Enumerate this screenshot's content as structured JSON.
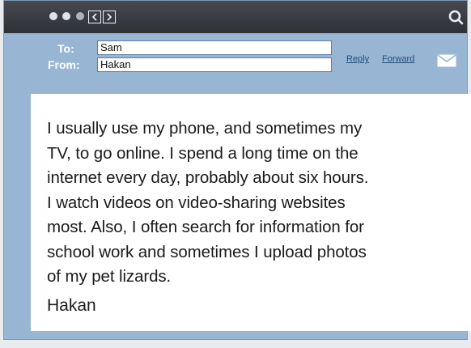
{
  "email": {
    "to_label": "To:",
    "to_value": "Sam",
    "from_label": "From:",
    "from_value": "Hakan",
    "reply_label": "Reply",
    "forward_label": "Forward",
    "message": "I usually use my phone, and sometimes my\nTV, to go online. I spend a long time on the\ninternet every day, probably about six hours.\nI watch videos on video-sharing websites\nmost. Also, I often search for information for\nschool work and sometimes I upload photos\nof my pet lizards.",
    "signature": "Hakan"
  },
  "toolbar": {
    "icons": [
      "close-dot-icon",
      "minimize-dot-icon",
      "zoom-dot-icon",
      "chevron-left-icon",
      "chevron-right-icon",
      "search-icon",
      "envelope-icon"
    ]
  },
  "colors": {
    "titlebar": "#3a3d42",
    "header_bg": "#98b6d3",
    "link": "#234d7a",
    "body_bg": "#ffffff"
  }
}
